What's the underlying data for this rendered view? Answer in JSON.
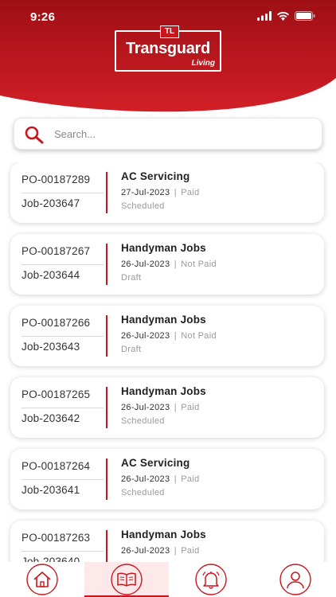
{
  "status_bar": {
    "time": "9:26",
    "icons": [
      "signal-icon",
      "wifi-icon",
      "battery-icon"
    ]
  },
  "header": {
    "logo": {
      "badge": "TL",
      "title": "Transguard",
      "subtitle": "Living"
    },
    "colors": {
      "brand_red": "#c8161d",
      "brand_dark": "#9e0f14"
    }
  },
  "search": {
    "placeholder": "Search...",
    "value": ""
  },
  "jobs": [
    {
      "po": "PO-00187289",
      "job": "Job-203647",
      "title": "AC Servicing",
      "date": "27-Jul-2023",
      "separator": "|",
      "payment": "Paid",
      "status": "Scheduled"
    },
    {
      "po": "PO-00187267",
      "job": "Job-203644",
      "title": "Handyman Jobs",
      "date": "26-Jul-2023",
      "separator": "|",
      "payment": "Not Paid",
      "status": "Draft"
    },
    {
      "po": "PO-00187266",
      "job": "Job-203643",
      "title": "Handyman Jobs",
      "date": "26-Jul-2023",
      "separator": "|",
      "payment": "Not Paid",
      "status": "Draft"
    },
    {
      "po": "PO-00187265",
      "job": "Job-203642",
      "title": "Handyman Jobs",
      "date": "26-Jul-2023",
      "separator": "|",
      "payment": "Paid",
      "status": "Scheduled"
    },
    {
      "po": "PO-00187264",
      "job": "Job-203641",
      "title": "AC Servicing",
      "date": "26-Jul-2023",
      "separator": "|",
      "payment": "Paid",
      "status": "Scheduled"
    },
    {
      "po": "PO-00187263",
      "job": "Job-203640",
      "title": "Handyman Jobs",
      "date": "26-Jul-2023",
      "separator": "|",
      "payment": "Paid",
      "status": ""
    }
  ],
  "bottom_nav": {
    "items": [
      {
        "icon": "home-icon",
        "active": false
      },
      {
        "icon": "book-icon",
        "active": true
      },
      {
        "icon": "bell-icon",
        "active": false
      },
      {
        "icon": "profile-icon",
        "active": false
      }
    ]
  }
}
